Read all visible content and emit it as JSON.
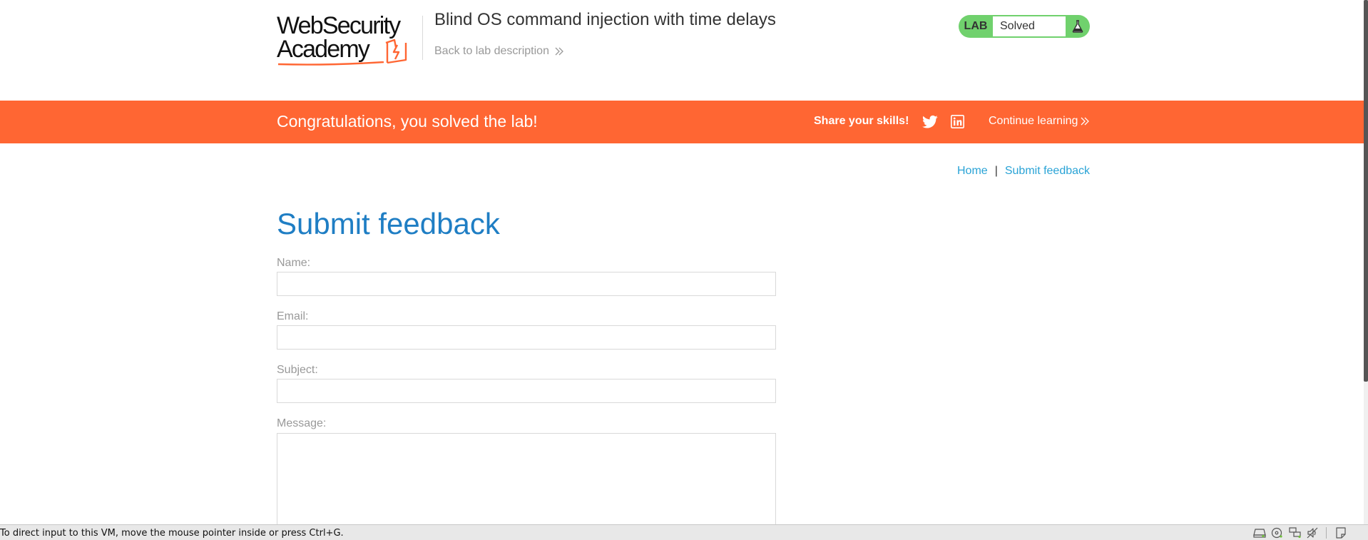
{
  "header": {
    "logo_line1": "WebSecurity",
    "logo_line2": "Academy",
    "lab_title": "Blind OS command injection with time delays",
    "back_link": "Back to lab description"
  },
  "lab_status": {
    "tag": "LAB",
    "state": "Solved",
    "accent_color": "#70d16d",
    "icon": "flask-icon"
  },
  "banner": {
    "message": "Congratulations, you solved the lab!",
    "share_label": "Share your skills!",
    "share_icons": [
      "twitter-icon",
      "linkedin-icon"
    ],
    "continue_link": "Continue learning",
    "color": "#ff6633"
  },
  "nav": {
    "home": "Home",
    "separator": "|",
    "feedback": "Submit feedback"
  },
  "form": {
    "heading": "Submit feedback",
    "name_label": "Name:",
    "name_value": "",
    "email_label": "Email:",
    "email_value": "",
    "subject_label": "Subject:",
    "subject_value": "",
    "message_label": "Message:",
    "message_value": ""
  },
  "vm": {
    "hint": "To direct input to this VM, move the mouse pointer inside or press Ctrl+G.",
    "tray_icons": [
      "hard-disk-icon",
      "optical-drive-icon",
      "network-icon",
      "audio-icon",
      "notes-icon"
    ]
  }
}
